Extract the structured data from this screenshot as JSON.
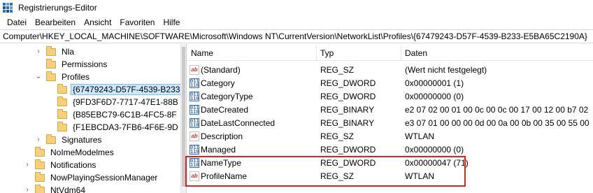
{
  "window": {
    "title": "Registrierungs-Editor"
  },
  "menu": [
    "Datei",
    "Bearbeiten",
    "Ansicht",
    "Favoriten",
    "Hilfe"
  ],
  "address": "Computer\\HKEY_LOCAL_MACHINE\\SOFTWARE\\Microsoft\\Windows NT\\CurrentVersion\\NetworkList\\Profiles\\{67479243-D57F-4539-B233-E5BA65C2190A}",
  "tree": [
    {
      "label": "Nla",
      "chevron": "›"
    },
    {
      "label": "Permissions",
      "chevron": ""
    },
    {
      "label": "Profiles",
      "chevron": "⌄"
    },
    {
      "label": "{67479243-D57F-4539-B233",
      "chevron": ""
    },
    {
      "label": "{9FD3F6D7-7717-47E1-88B",
      "chevron": ""
    },
    {
      "label": "{B85EBC79-6C1B-4FC5-8F",
      "chevron": ""
    },
    {
      "label": "{F1EBCDA3-7FB6-4F6E-9D",
      "chevron": ""
    },
    {
      "label": "Signatures",
      "chevron": "›"
    },
    {
      "label": "NoImeModelmes",
      "chevron": ""
    },
    {
      "label": "Notifications",
      "chevron": "›"
    },
    {
      "label": "NowPlayingSessionManager",
      "chevron": ""
    },
    {
      "label": "NtVdm64",
      "chevron": "›"
    }
  ],
  "columns": {
    "name": "Name",
    "type": "Typ",
    "data": "Daten"
  },
  "values": [
    {
      "icon": "string-value-icon",
      "name": "(Standard)",
      "type": "REG_SZ",
      "data": "(Wert nicht festgelegt)"
    },
    {
      "icon": "binary-value-icon",
      "name": "Category",
      "type": "REG_DWORD",
      "data": "0x00000001 (1)"
    },
    {
      "icon": "binary-value-icon",
      "name": "CategoryType",
      "type": "REG_DWORD",
      "data": "0x00000000 (0)"
    },
    {
      "icon": "binary-value-icon",
      "name": "DateCreated",
      "type": "REG_BINARY",
      "data": "e2 07 02 00 01 00 0c 00 0c 00 17 00 12 00 b7 02"
    },
    {
      "icon": "binary-value-icon",
      "name": "DateLastConnected",
      "type": "REG_BINARY",
      "data": "e3 07 01 00 00 00 0d 00 0a 00 0b 00 35 00 55 00"
    },
    {
      "icon": "string-value-icon",
      "name": "Description",
      "type": "REG_SZ",
      "data": "WTLAN"
    },
    {
      "icon": "binary-value-icon",
      "name": "Managed",
      "type": "REG_DWORD",
      "data": "0x00000000 (0)"
    },
    {
      "icon": "binary-value-icon",
      "name": "NameType",
      "type": "REG_DWORD",
      "data": "0x00000047 (71)"
    },
    {
      "icon": "string-value-icon",
      "name": "ProfileName",
      "type": "REG_SZ",
      "data": "WTLAN"
    }
  ],
  "icon_glyphs": {
    "string": "ab",
    "binary": "011\n110"
  },
  "colors": {
    "highlight": "#e02020",
    "selection": "#cce8ff",
    "folder": "#f6d07a"
  }
}
